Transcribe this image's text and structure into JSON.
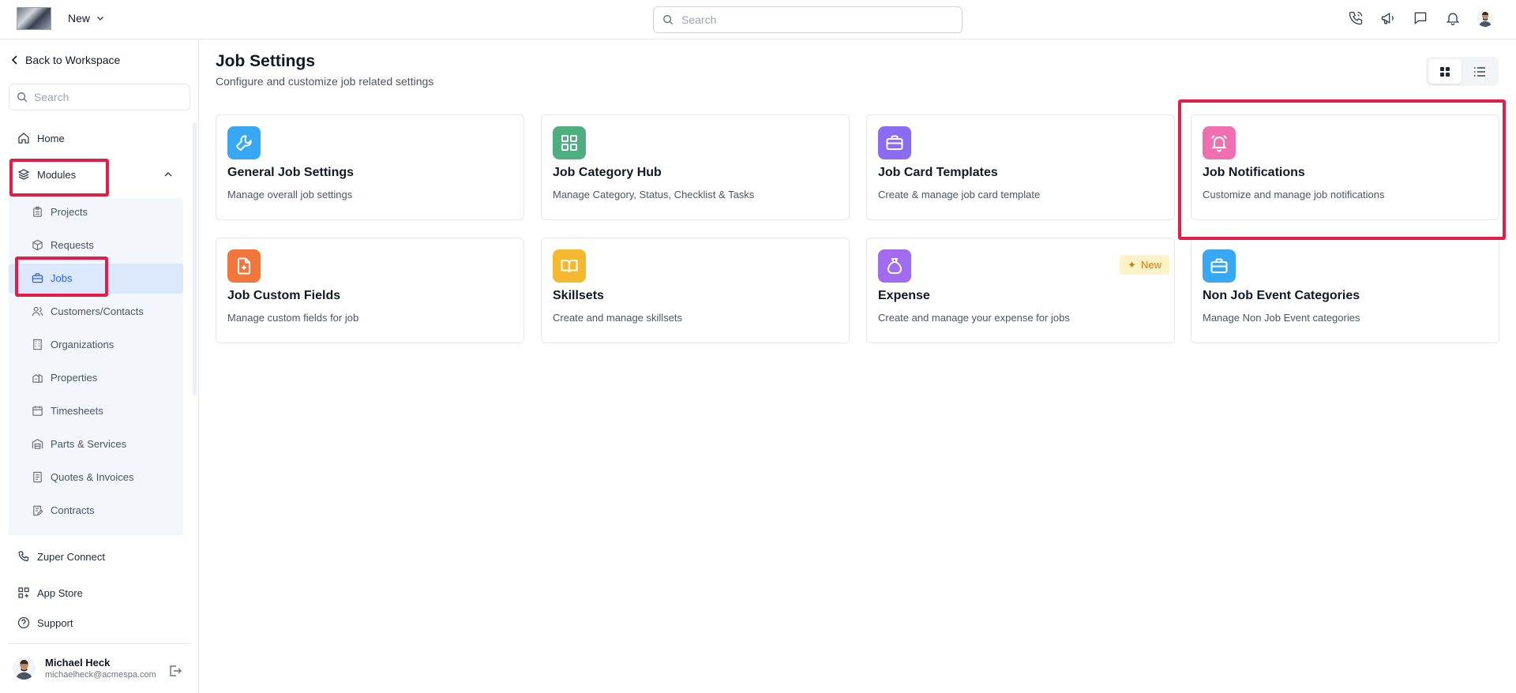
{
  "topbar": {
    "new_label": "New",
    "search_placeholder": "Search",
    "icons": [
      "phone-icon",
      "megaphone-icon",
      "chat-icon",
      "bell-icon",
      "avatar"
    ]
  },
  "sidebar": {
    "back_label": "Back to Workspace",
    "search_placeholder": "Search",
    "home_label": "Home",
    "modules_label": "Modules",
    "sub_items": [
      {
        "label": "Projects",
        "icon": "clipboard-icon"
      },
      {
        "label": "Requests",
        "icon": "box-icon"
      },
      {
        "label": "Jobs",
        "icon": "briefcase-icon",
        "active": true
      },
      {
        "label": "Customers/Contacts",
        "icon": "users-icon"
      },
      {
        "label": "Organizations",
        "icon": "building-icon"
      },
      {
        "label": "Properties",
        "icon": "property-icon"
      },
      {
        "label": "Timesheets",
        "icon": "calendar-icon"
      },
      {
        "label": "Parts & Services",
        "icon": "warehouse-icon"
      },
      {
        "label": "Quotes & Invoices",
        "icon": "invoice-icon"
      },
      {
        "label": "Contracts",
        "icon": "contract-icon"
      }
    ],
    "bottom_items": [
      {
        "label": "Zuper Connect",
        "icon": "phone-icon"
      },
      {
        "label": "App Store",
        "icon": "apps-icon"
      },
      {
        "label": "Support",
        "icon": "help-icon"
      }
    ],
    "user": {
      "name": "Michael Heck",
      "email": "michaelheck@acmespa.com"
    }
  },
  "main": {
    "title": "Job Settings",
    "subtitle": "Configure and customize job related settings",
    "cards": [
      {
        "title": "General Job Settings",
        "desc": "Manage overall job settings",
        "icon": "wrench-icon",
        "color": "#38a8f5"
      },
      {
        "title": "Job Category Hub",
        "desc": "Manage Category, Status, Checklist & Tasks",
        "icon": "grid-icon",
        "color": "#4caf7d"
      },
      {
        "title": "Job Card Templates",
        "desc": "Create & manage job card template",
        "icon": "briefcase-icon",
        "color": "#8b6cf0"
      },
      {
        "title": "Job Notifications",
        "desc": "Customize and manage job notifications",
        "icon": "bell-ring-icon",
        "color": "#f06fb0"
      },
      {
        "title": "Job Custom Fields",
        "desc": "Manage custom fields for job",
        "icon": "file-plus-icon",
        "color": "#f2753c"
      },
      {
        "title": "Skillsets",
        "desc": "Create and manage skillsets",
        "icon": "book-icon",
        "color": "#f5b82e"
      },
      {
        "title": "Expense",
        "desc": "Create and manage your expense for jobs",
        "icon": "money-bag-icon",
        "color": "#a16cf0",
        "badge": "New"
      },
      {
        "title": "Non Job Event Categories",
        "desc": "Manage Non Job Event categories",
        "icon": "briefcase-icon",
        "color": "#38a8f5"
      }
    ]
  }
}
